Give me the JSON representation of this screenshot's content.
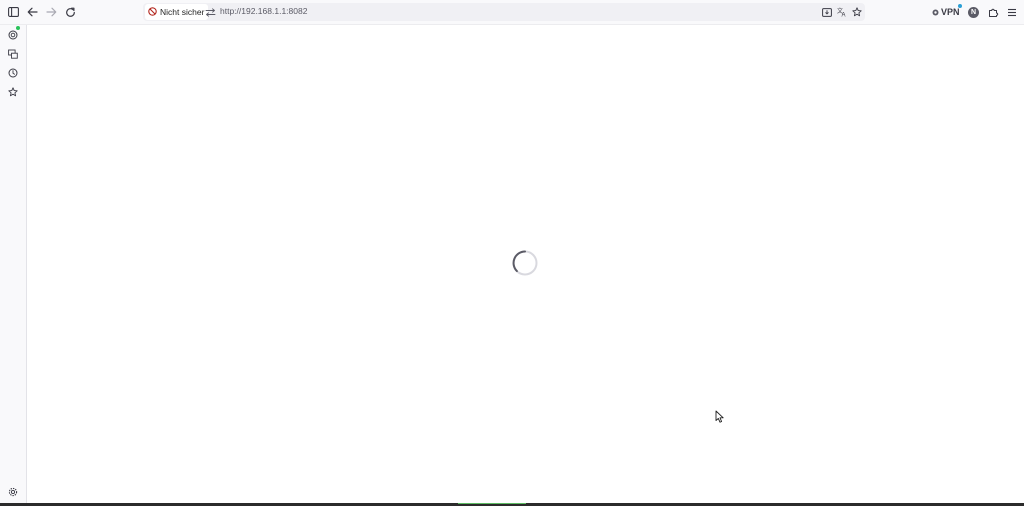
{
  "toolbar": {
    "sidebar_toggle_icon": "sidebar-icon",
    "back_icon": "arrow-left-icon",
    "forward_icon": "arrow-right-icon",
    "reload_icon": "reload-icon",
    "url": {
      "security_label": "Nicht sicher",
      "value": "http://192.168.1.1:8082"
    },
    "right": {
      "vpn_label": "VPN",
      "avatar_letter": "N"
    }
  },
  "sidebar": {
    "items": [
      {
        "icon": "ai-chat-icon",
        "has_notification": true
      },
      {
        "icon": "synced-tabs-icon"
      },
      {
        "icon": "history-icon"
      },
      {
        "icon": "bookmarks-star-icon"
      }
    ],
    "bottom_icon": "settings-gear-icon"
  },
  "content": {
    "state": "loading"
  },
  "colors": {
    "toolbar_bg": "#f9f9fb",
    "urlbar_bg": "#f0f0f4",
    "notification_green": "#2ac35a",
    "vpn_blue": "#2a9fd6"
  }
}
